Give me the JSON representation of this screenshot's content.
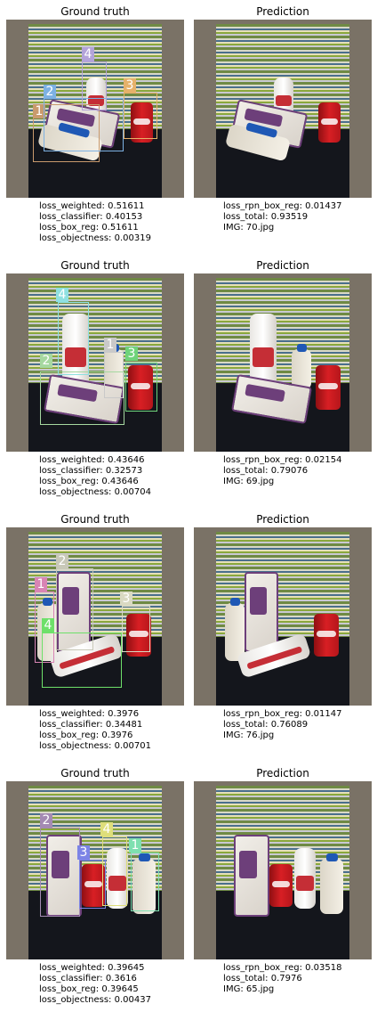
{
  "titles": {
    "ground_truth": "Ground truth",
    "prediction": "Prediction"
  },
  "rows": [
    {
      "gt_labels": [
        "1",
        "2",
        "3",
        "4"
      ],
      "stats_left": [
        "loss_weighted: 0.51611",
        "loss_classifier: 0.40153",
        "loss_box_reg: 0.51611",
        "loss_objectness: 0.00319"
      ],
      "stats_right": [
        "loss_rpn_box_reg: 0.01437",
        "loss_total: 0.93519",
        "IMG: 70.jpg"
      ]
    },
    {
      "gt_labels": [
        "1",
        "2",
        "3",
        "4"
      ],
      "stats_left": [
        "loss_weighted: 0.43646",
        "loss_classifier: 0.32573",
        "loss_box_reg: 0.43646",
        "loss_objectness: 0.00704"
      ],
      "stats_right": [
        "loss_rpn_box_reg: 0.02154",
        "loss_total: 0.79076",
        "IMG: 69.jpg"
      ]
    },
    {
      "gt_labels": [
        "1",
        "2",
        "3",
        "4"
      ],
      "stats_left": [
        "loss_weighted: 0.3976",
        "loss_classifier: 0.34481",
        "loss_box_reg: 0.3976",
        "loss_objectness: 0.00701"
      ],
      "stats_right": [
        "loss_rpn_box_reg: 0.01147",
        "loss_total: 0.76089",
        "IMG: 76.jpg"
      ]
    },
    {
      "gt_labels": [
        "1",
        "2",
        "3",
        "4"
      ],
      "stats_left": [
        "loss_weighted: 0.39645",
        "loss_classifier: 0.3616",
        "loss_box_reg: 0.39645",
        "loss_objectness: 0.00437"
      ],
      "stats_right": [
        "loss_rpn_box_reg: 0.03518",
        "loss_total: 0.7976",
        "IMG: 65.jpg"
      ]
    }
  ],
  "box_colors": {
    "1": "#c99a6d",
    "2": "#7db1e3",
    "3": "#e6b16a",
    "4": "#b3a3d9"
  }
}
